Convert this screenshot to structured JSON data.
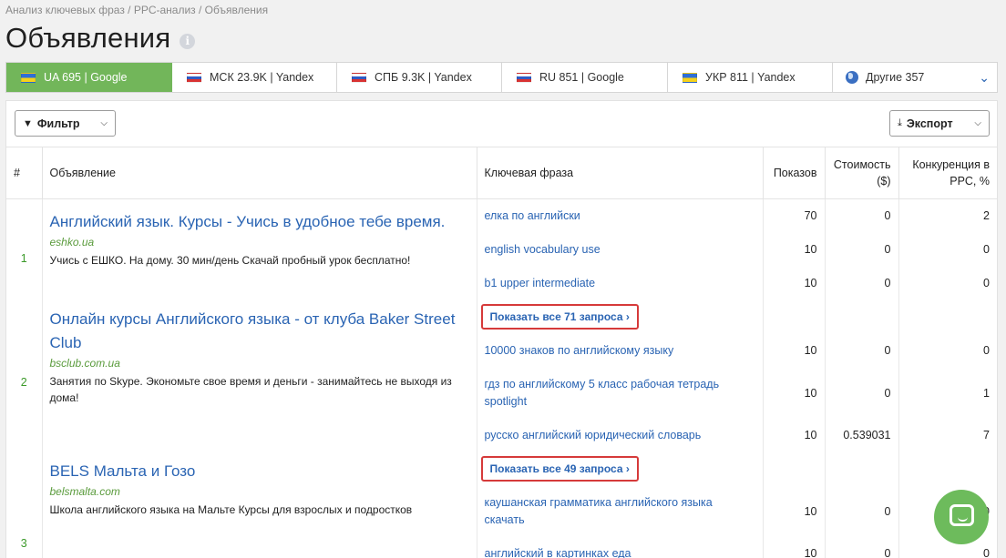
{
  "breadcrumb": "Анализ ключевых фраз / PPC-анализ / Объявления",
  "page_title": "Объявления",
  "info_icon": "i",
  "db_tabs": [
    {
      "label": "UA 695 | Google",
      "flag": "ua",
      "active": true
    },
    {
      "label": "МСК 23.9K | Yandex",
      "flag": "ru"
    },
    {
      "label": "СПБ 9.3K | Yandex",
      "flag": "ru"
    },
    {
      "label": "RU 851 | Google",
      "flag": "ru"
    },
    {
      "label": "УКР 811 | Yandex",
      "flag": "ua"
    },
    {
      "label": "Другие 357",
      "flag": "globe"
    }
  ],
  "toolbar": {
    "filter_label": "Фильтр",
    "export_label": "Экспорт"
  },
  "columns": {
    "idx": "#",
    "ad": "Объявление",
    "keyword": "Ключевая фраза",
    "shows": "Показов",
    "cost": "Стоимость ($)",
    "competition": "Конкуренция в PPC, %"
  },
  "ads": [
    {
      "idx": "1",
      "title": "Английский язык. Курсы - Учись в удобное тебе время.",
      "url": "eshko.ua",
      "text": "Учись с ЕШКО. На дому. 30 мин/день Скачай пробный урок бесплатно!",
      "keywords": [
        {
          "phrase": "елка по английски",
          "shows": "70",
          "cost": "0",
          "competition": "2"
        },
        {
          "phrase": "english vocabulary use",
          "shows": "10",
          "cost": "0",
          "competition": "0"
        },
        {
          "phrase": "b1 upper intermediate",
          "shows": "10",
          "cost": "0",
          "competition": "0"
        }
      ],
      "show_all": "Показать все 71 запроса ›"
    },
    {
      "idx": "2",
      "title": "Онлайн курсы Английского языка - от клуба Baker Street Club",
      "url": "bsclub.com.ua",
      "text": "Занятия по Skype. Экономьте свое время и деньги - занимайтесь не выходя из дома!",
      "keywords": [
        {
          "phrase": "10000 знаков по английскому языку",
          "shows": "10",
          "cost": "0",
          "competition": "0"
        },
        {
          "phrase": "гдз по английскому 5 класс рабочая тетрадь spotlight",
          "shows": "10",
          "cost": "0",
          "competition": "1"
        },
        {
          "phrase": "русско английский юридический словарь",
          "shows": "10",
          "cost": "0.539031",
          "competition": "7"
        }
      ],
      "show_all": "Показать все 49 запроса ›"
    },
    {
      "idx": "3",
      "title": "BELS Мальта и Гозо",
      "url": "belsmalta.com",
      "text": "Школа английского языка на Мальте Курсы для взрослых и подростков",
      "keywords": [
        {
          "phrase": "каушанская грамматика английского языка скачать",
          "shows": "10",
          "cost": "0",
          "competition": "0"
        },
        {
          "phrase": "английский в картинках еда",
          "shows": "10",
          "cost": "0",
          "competition": "0"
        }
      ]
    }
  ],
  "colors": {
    "accent_green": "#72b65a",
    "link_blue": "#2a64b3",
    "highlight_red": "#d63a3a"
  }
}
